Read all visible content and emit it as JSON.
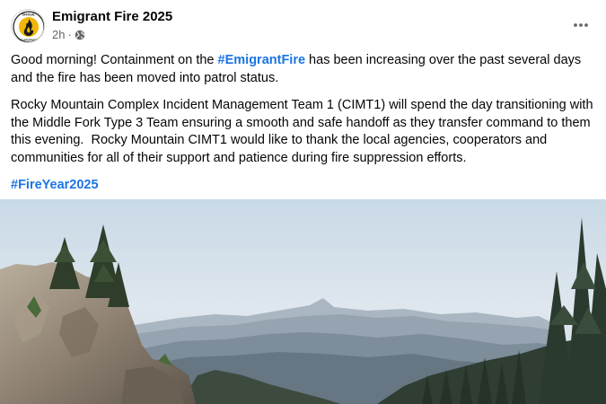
{
  "post": {
    "page_name": "Emigrant Fire 2025",
    "time": "2h",
    "separator": "·",
    "audience_icon": "globe-icon",
    "avatar_icon": "official-fire-information-logo",
    "avatar_text_top": "OFFICIAL",
    "avatar_text_bottom": "FIRE INFORMATION",
    "more_icon": "more-options-icon",
    "para1_pre": "Good morning! Containment on the ",
    "para1_hashtag": "#EmigrantFire",
    "para1_post": " has been increasing over the past several days and the fire has been moved into patrol status.",
    "para2": "Rocky Mountain Complex Incident Management Team 1 (CIMT1) will spend the day transitioning with the Middle Fork Type 3 Team ensuring a smooth and safe handoff as they transfer command to them this evening.  Rocky Mountain CIMT1 would like to thank the local agencies, cooperators and communities for all of their support and patience during fire suppression efforts.",
    "hashtag2": "#FireYear2025",
    "image": "mountain-landscape-photo"
  },
  "colors": {
    "text": "#050505",
    "secondary": "#65676b",
    "link": "#1b74e4",
    "logo_gold": "#f2b705",
    "logo_dark": "#1a1a1a"
  }
}
